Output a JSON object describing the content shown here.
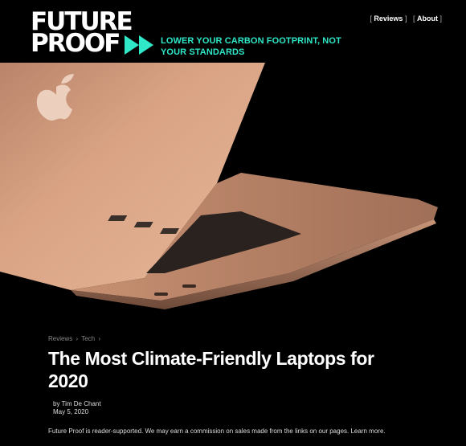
{
  "header": {
    "logo_line1": "FUTURE",
    "logo_line2": "PROOF",
    "tagline": "LOWER YOUR CARBON FOOTPRINT, NOT YOUR STANDARDS",
    "nav": [
      {
        "label": "Reviews"
      },
      {
        "label": "About"
      }
    ],
    "accent": "#2ee8c8"
  },
  "hero": {
    "subject": "laptop-photo",
    "colors": {
      "body": "#d8a07f",
      "background": "#000000"
    }
  },
  "article": {
    "breadcrumb": [
      "Reviews",
      "Tech"
    ],
    "breadcrumb_sep": "›",
    "title": "The Most Climate-Friendly Laptops for 2020",
    "author": "by Tim De Chant",
    "date": "May 5, 2020",
    "disclaimer": "Future Proof is reader-supported. We may earn a commission on sales made from the links on our pages.",
    "learn_more": "Learn more."
  }
}
